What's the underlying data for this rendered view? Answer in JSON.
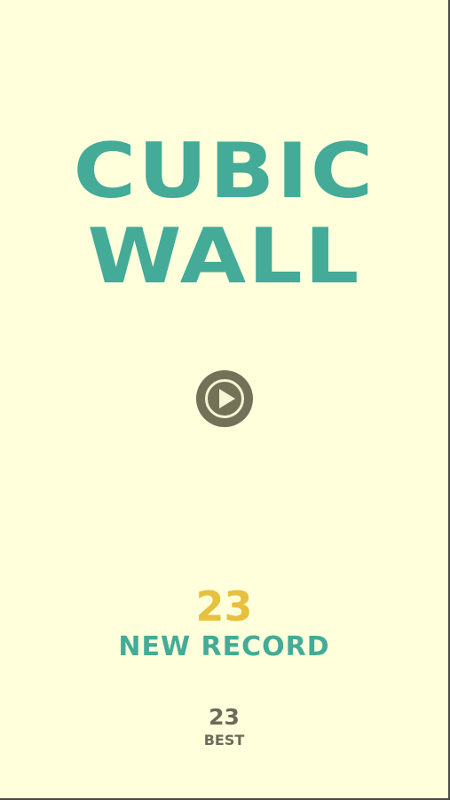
{
  "game": {
    "title_line_1": "CUBIC",
    "title_line_2": "WALL",
    "play_icon": "play-icon",
    "score": "23",
    "record_label": "NEW RECORD",
    "best_score": "23",
    "best_label": "BEST"
  },
  "colors": {
    "background": "#ffffdc",
    "title": "#43ab98",
    "score": "#e7c13d",
    "play_button": "#737258",
    "best_text": "#6b6b59"
  }
}
